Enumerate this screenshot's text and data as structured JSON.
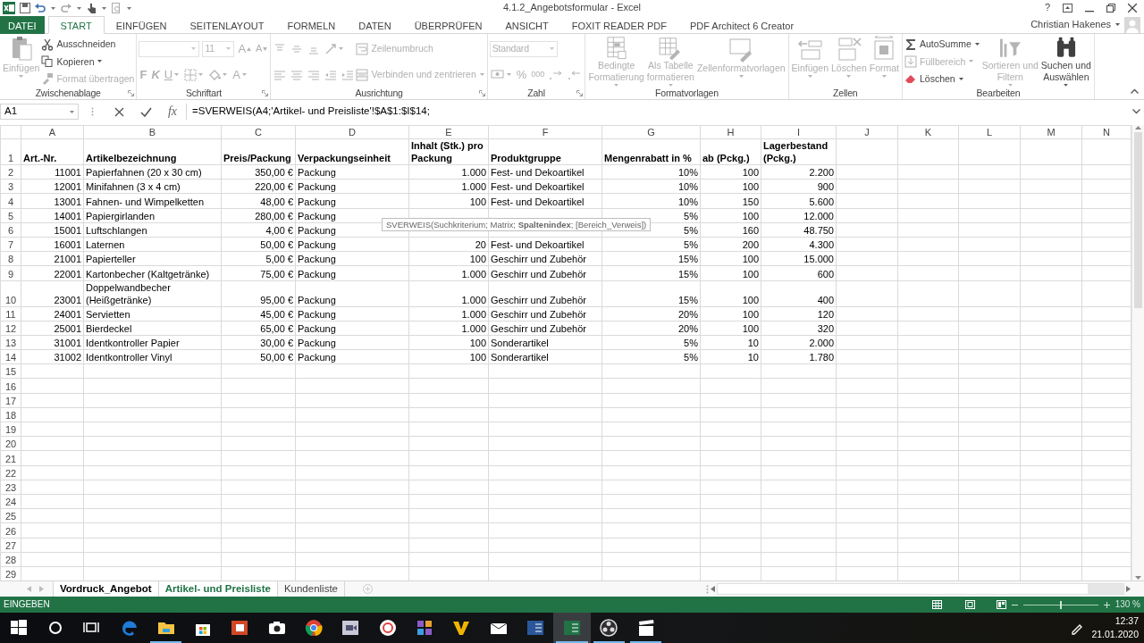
{
  "window": {
    "title": "4.1.2_Angebotsformular - Excel",
    "help": "?",
    "user": "Christian Hakenes"
  },
  "tabs": [
    {
      "label": "DATEI",
      "kind": "file",
      "selected": false
    },
    {
      "label": "START",
      "kind": "tab",
      "selected": true
    },
    {
      "label": "EINFÜGEN",
      "kind": "tab",
      "selected": false
    },
    {
      "label": "SEITENLAYOUT",
      "kind": "tab",
      "selected": false
    },
    {
      "label": "FORMELN",
      "kind": "tab",
      "selected": false
    },
    {
      "label": "DATEN",
      "kind": "tab",
      "selected": false
    },
    {
      "label": "ÜBERPRÜFEN",
      "kind": "tab",
      "selected": false
    },
    {
      "label": "ANSICHT",
      "kind": "tab",
      "selected": false
    },
    {
      "label": "FOXIT READER PDF",
      "kind": "tab",
      "selected": false
    },
    {
      "label": "PDF Architect 6 Creator",
      "kind": "tab",
      "selected": false
    }
  ],
  "ribbon": [
    {
      "label": "Zwischenablage",
      "launcher": true,
      "columns": [
        [
          [
            {
              "kind": "large",
              "lines": [
                "Einfügen"
              ],
              "disabled": true,
              "dropdown": true
            }
          ]
        ],
        [
          [
            {
              "kind": "small",
              "label": "Ausschneiden",
              "disabled": false,
              "dropdown": false
            }
          ],
          [
            {
              "kind": "small",
              "label": "Kopieren",
              "disabled": false,
              "dropdown": true
            }
          ],
          [
            {
              "kind": "small",
              "label": "Format übertragen",
              "disabled": true,
              "dropdown": false
            }
          ]
        ]
      ]
    },
    {
      "label": "Schriftart",
      "launcher": true,
      "columns": [
        [
          [
            {
              "kind": "field",
              "disabled": true,
              "dropdown": true
            },
            {
              "kind": "field",
              "value": "11",
              "disabled": true,
              "dropdown": true
            },
            {
              "kind": "glyph",
              "label": "A",
              "disabled": true,
              "dropdown": false
            },
            {
              "kind": "glyph",
              "label": "A",
              "disabled": true,
              "dropdown": false
            }
          ],
          [
            {
              "kind": "glyph",
              "label": "F",
              "disabled": true,
              "dropdown": false
            },
            {
              "kind": "glyph",
              "label": "K",
              "disabled": true,
              "dropdown": false
            },
            {
              "kind": "glyph",
              "label": "U",
              "disabled": true,
              "dropdown": true
            },
            {
              "kind": "icon",
              "disabled": true,
              "dropdown": true
            },
            {
              "kind": "icon",
              "disabled": true,
              "dropdown": true
            },
            {
              "kind": "glyph",
              "label": "A",
              "disabled": true,
              "dropdown": true
            }
          ]
        ]
      ]
    },
    {
      "label": "Ausrichtung",
      "launcher": true,
      "columns": [
        [
          [
            {
              "kind": "icon",
              "disabled": true,
              "dropdown": false
            },
            {
              "kind": "icon",
              "disabled": true,
              "dropdown": false
            },
            {
              "kind": "icon",
              "disabled": true,
              "dropdown": false
            },
            {
              "kind": "icon",
              "disabled": true,
              "dropdown": true
            }
          ],
          [
            {
              "kind": "icon",
              "disabled": true,
              "dropdown": false
            },
            {
              "kind": "icon",
              "disabled": true,
              "dropdown": false
            },
            {
              "kind": "icon",
              "disabled": true,
              "dropdown": false
            },
            {
              "kind": "icon",
              "disabled": true,
              "dropdown": false
            },
            {
              "kind": "icon",
              "disabled": true,
              "dropdown": false
            }
          ]
        ],
        [
          [
            {
              "kind": "small",
              "label": "Zeilenumbruch",
              "disabled": true,
              "dropdown": false
            }
          ],
          [
            {
              "kind": "small",
              "label": "Verbinden und zentrieren",
              "disabled": true,
              "dropdown": true
            }
          ]
        ]
      ]
    },
    {
      "label": "Zahl",
      "launcher": true,
      "columns": [
        [
          [
            {
              "kind": "field",
              "value": "Standard",
              "disabled": true,
              "dropdown": true
            }
          ],
          [
            {
              "kind": "icon",
              "disabled": true,
              "dropdown": true
            },
            {
              "kind": "glyph",
              "label": "%",
              "disabled": true,
              "dropdown": false
            },
            {
              "kind": "glyph",
              "label": "000",
              "disabled": true,
              "dropdown": false
            },
            {
              "kind": "icon",
              "disabled": true,
              "dropdown": false
            },
            {
              "kind": "icon",
              "disabled": true,
              "dropdown": false
            }
          ]
        ]
      ]
    },
    {
      "label": "Formatvorlagen",
      "launcher": false,
      "columns": [
        [
          [
            {
              "kind": "large",
              "lines": [
                "Bedingte",
                "Formatierung"
              ],
              "disabled": true,
              "dropdown": true
            }
          ]
        ],
        [
          [
            {
              "kind": "large",
              "lines": [
                "Als Tabelle",
                "formatieren"
              ],
              "disabled": true,
              "dropdown": true
            }
          ]
        ],
        [
          [
            {
              "kind": "large",
              "lines": [
                "Zellenformatvorlagen"
              ],
              "disabled": true,
              "dropdown": true
            }
          ]
        ]
      ]
    },
    {
      "label": "Zellen",
      "launcher": false,
      "columns": [
        [
          [
            {
              "kind": "large",
              "lines": [
                "Einfügen"
              ],
              "disabled": true,
              "dropdown": true
            }
          ]
        ],
        [
          [
            {
              "kind": "large",
              "lines": [
                "Löschen"
              ],
              "disabled": true,
              "dropdown": true
            }
          ]
        ],
        [
          [
            {
              "kind": "large",
              "lines": [
                "Format"
              ],
              "disabled": true,
              "dropdown": true
            }
          ]
        ]
      ]
    },
    {
      "label": "Bearbeiten",
      "launcher": false,
      "columns": [
        [
          [
            {
              "kind": "small",
              "label": "AutoSumme",
              "disabled": false,
              "dropdown": true
            }
          ],
          [
            {
              "kind": "small",
              "label": "Füllbereich",
              "disabled": true,
              "dropdown": true
            }
          ],
          [
            {
              "kind": "small",
              "label": "Löschen",
              "disabled": false,
              "dropdown": true
            }
          ]
        ],
        [
          [
            {
              "kind": "large",
              "lines": [
                "Sortieren und",
                "Filtern"
              ],
              "disabled": true,
              "dropdown": true
            }
          ]
        ],
        [
          [
            {
              "kind": "large",
              "lines": [
                "Suchen und",
                "Auswählen"
              ],
              "disabled": false,
              "dropdown": true
            }
          ]
        ]
      ]
    }
  ],
  "formula_bar": {
    "name_box": "A1",
    "function_label": "fx",
    "formula": "=SVERWEIS(A4;'Artikel- und Preisliste'!$A$1:$I$14;"
  },
  "sheet": {
    "columns": [
      "A",
      "B",
      "C",
      "D",
      "E",
      "F",
      "G",
      "H",
      "I",
      "J",
      "K",
      "L",
      "M",
      "N"
    ],
    "row_numbers": [
      "1",
      "2",
      "3",
      "4",
      "5",
      "6",
      "7",
      "8",
      "9",
      "10",
      "11",
      "12",
      "13",
      "14",
      "15",
      "16",
      "17",
      "18",
      "19",
      "20",
      "21",
      "22",
      "23",
      "24",
      "25",
      "26",
      "27",
      "28",
      "29"
    ],
    "rows": [
      {
        "kind": "header",
        "wrap": true,
        "cells": [
          "Art.-Nr.",
          "Artikelbezeichnung",
          "Preis/Packung",
          "Verpackungseinheit",
          "Inhalt (Stk.) pro Packung",
          "Produktgruppe",
          "Mengenrabatt in %",
          "ab (Pckg.)",
          "Lagerbestand (Pckg.)"
        ]
      },
      {
        "kind": "data",
        "wrap": false,
        "cells": [
          "11001",
          "Papierfahnen (20 x 30 cm)",
          "350,00 €",
          "Packung",
          "1.000",
          "Fest- und Dekoartikel",
          "10%",
          "100",
          "2.200"
        ]
      },
      {
        "kind": "data",
        "wrap": false,
        "cells": [
          "12001",
          "Minifahnen (3 x 4 cm)",
          "220,00 €",
          "Packung",
          "1.000",
          "Fest- und Dekoartikel",
          "10%",
          "100",
          "900"
        ]
      },
      {
        "kind": "data",
        "wrap": false,
        "cells": [
          "13001",
          "Fahnen- und Wimpelketten",
          "48,00 €",
          "Packung",
          "100",
          "Fest- und Dekoartikel",
          "10%",
          "150",
          "5.600"
        ]
      },
      {
        "kind": "data",
        "wrap": false,
        "cells": [
          "14001",
          "Papiergirlanden",
          "280,00 €",
          "Packung",
          null,
          null,
          "5%",
          "100",
          "12.000"
        ]
      },
      {
        "kind": "data",
        "wrap": false,
        "cells": [
          "15001",
          "Luftschlangen",
          "4,00 €",
          "Packung",
          null,
          null,
          "5%",
          "160",
          "48.750"
        ]
      },
      {
        "kind": "data",
        "wrap": false,
        "cells": [
          "16001",
          "Laternen",
          "50,00 €",
          "Packung",
          "20",
          "Fest- und Dekoartikel",
          "5%",
          "200",
          "4.300"
        ]
      },
      {
        "kind": "data",
        "wrap": false,
        "cells": [
          "21001",
          "Papierteller",
          "5,00 €",
          "Packung",
          "100",
          "Geschirr und Zubehör",
          "15%",
          "100",
          "15.000"
        ]
      },
      {
        "kind": "data",
        "wrap": false,
        "cells": [
          "22001",
          "Kartonbecher (Kaltgetränke)",
          "75,00 €",
          "Packung",
          "1.000",
          "Geschirr und Zubehör",
          "15%",
          "100",
          "600"
        ]
      },
      {
        "kind": "data",
        "wrap": true,
        "cells": [
          "23001",
          "Doppelwandbecher (Heißgetränke)",
          "95,00 €",
          "Packung",
          "1.000",
          "Geschirr und Zubehör",
          "15%",
          "100",
          "400"
        ]
      },
      {
        "kind": "data",
        "wrap": false,
        "cells": [
          "24001",
          "Servietten",
          "45,00 €",
          "Packung",
          "1.000",
          "Geschirr und Zubehör",
          "20%",
          "100",
          "120"
        ]
      },
      {
        "kind": "data",
        "wrap": false,
        "cells": [
          "25001",
          "Bierdeckel",
          "65,00 €",
          "Packung",
          "1.000",
          "Geschirr und Zubehör",
          "20%",
          "100",
          "320"
        ]
      },
      {
        "kind": "data",
        "wrap": false,
        "cells": [
          "31001",
          "Identkontroller Papier",
          "30,00 €",
          "Packung",
          "100",
          "Sonderartikel",
          "5%",
          "10",
          "2.000"
        ]
      },
      {
        "kind": "data",
        "wrap": false,
        "cells": [
          "31002",
          "Identkontroller Vinyl",
          "50,00 €",
          "Packung",
          "100",
          "Sonderartikel",
          "5%",
          "10",
          "1.780"
        ]
      }
    ],
    "tooltip": "SVERWEIS(Suchkriterium; Matrix; **Spaltenindex**; [Bereich_Verweis])"
  },
  "sheet_tabs": [
    {
      "label": "Vordruck_Angebot",
      "kind": "source",
      "selected": false
    },
    {
      "label": "Artikel- und Preisliste",
      "kind": "sheet",
      "selected": true
    },
    {
      "label": "Kundenliste",
      "kind": "sheet",
      "selected": false
    }
  ],
  "status_bar": {
    "mode": "EINGEBEN",
    "zoom": {
      "label": "130 %",
      "level": 0.5
    }
  },
  "taskbar": {
    "apps": [
      {
        "kind": "start",
        "running": false,
        "selected": false
      },
      {
        "kind": "search",
        "running": false,
        "selected": false
      },
      {
        "kind": "taskview",
        "running": false,
        "selected": false
      },
      {
        "kind": "edge",
        "running": false,
        "selected": false
      },
      {
        "kind": "explorer",
        "running": true,
        "selected": false
      },
      {
        "kind": "store",
        "running": false,
        "selected": false
      },
      {
        "kind": "powerpoint",
        "running": false,
        "selected": false
      },
      {
        "kind": "camera",
        "running": false,
        "selected": false
      },
      {
        "kind": "chrome",
        "running": false,
        "selected": false
      },
      {
        "kind": "video",
        "running": false,
        "selected": false
      },
      {
        "kind": "ring",
        "running": false,
        "selected": false
      },
      {
        "kind": "squares",
        "running": false,
        "selected": false
      },
      {
        "kind": "vee",
        "running": false,
        "selected": false
      },
      {
        "kind": "mail",
        "running": false,
        "selected": false
      },
      {
        "kind": "word",
        "running": false,
        "selected": false
      },
      {
        "kind": "excel",
        "running": true,
        "selected": true
      },
      {
        "kind": "obs",
        "running": true,
        "selected": false
      },
      {
        "kind": "clapper",
        "running": true,
        "selected": false
      }
    ],
    "time": "12:37",
    "date": "21.01.2020"
  }
}
